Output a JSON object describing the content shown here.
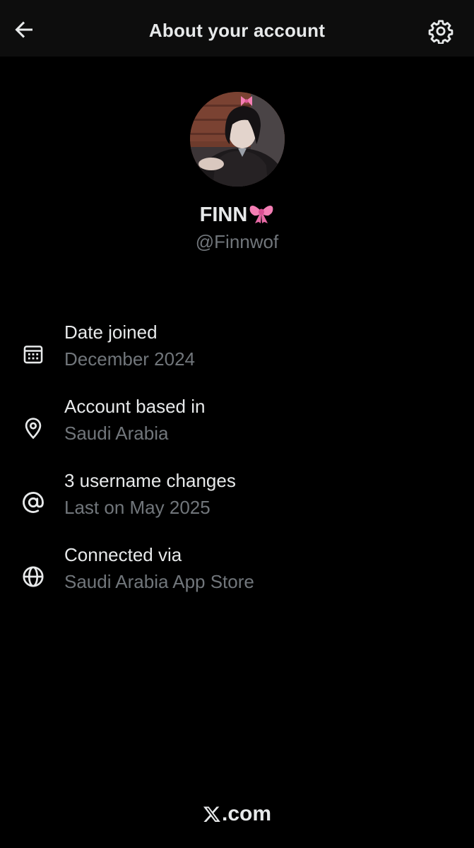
{
  "header": {
    "title": "About your account",
    "back_icon": "arrow-left-icon",
    "settings_icon": "gear-icon"
  },
  "profile": {
    "display_name": "FINN",
    "name_emoji": "ribbon-bow-emoji",
    "handle": "@Finnwof",
    "avatar": "profile-photo"
  },
  "info": [
    {
      "icon": "calendar-icon",
      "label": "Date joined",
      "value": "December 2024"
    },
    {
      "icon": "location-pin-icon",
      "label": "Account based in",
      "value": "Saudi Arabia"
    },
    {
      "icon": "at-sign-icon",
      "label": "3 username changes",
      "value": "Last on May 2025"
    },
    {
      "icon": "globe-icon",
      "label": "Connected via",
      "value": "Saudi Arabia App Store"
    }
  ],
  "footer": {
    "domain_suffix": ".com",
    "logo_icon": "x-logo-icon"
  },
  "colors": {
    "background": "#000000",
    "header_background": "#0d0d0d",
    "primary_text": "#e7e9ea",
    "secondary_text": "#71767b",
    "bow_pink": "#f47eb4"
  }
}
